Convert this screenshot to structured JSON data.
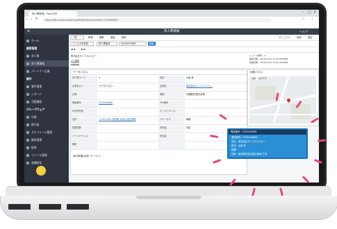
{
  "browser": {
    "tab_title": "求人票詳細 - PastCRM",
    "url": "https://file.cloud.example.jp/MMJ/fs/dir/entry/fkey/r=SU/0006SP"
  },
  "app": {
    "title": "求人票情報",
    "header_right": "ヘルプ"
  },
  "toolbar": {
    "back": "一覧",
    "new": "新規",
    "edit": "編集",
    "copy": "複製",
    "delete": "削除",
    "manual": "マニュアル",
    "print": "印刷",
    "settings": "設定"
  },
  "search": {
    "filter": "フィルタ未選択",
    "field": "求人票番号",
    "value": "000SKG5688",
    "button": "検索"
  },
  "record": {
    "company_label": "株式会社サンプルエスピー",
    "name": "山田",
    "meta1": "レコード番号：4",
    "meta2": "更新日時：2019/11/07 11:36 OPSMPB",
    "meta3": "登録日時：2019/11/07 11:04 OPSMPB"
  },
  "sidebar": {
    "items": [
      {
        "label": "ホーム",
        "header": false
      },
      {
        "label": "顧客管理",
        "header": true
      },
      {
        "label": "求人票",
        "header": false
      },
      {
        "label": "求人票情報",
        "header": false,
        "active": true
      },
      {
        "label": "パートナー企業",
        "header": false
      },
      {
        "label": "案件",
        "header": true
      },
      {
        "label": "案件管理",
        "header": false
      },
      {
        "label": "レポート",
        "header": false
      },
      {
        "label": "活動履歴",
        "header": false
      },
      {
        "label": "グループウェア",
        "header": true
      },
      {
        "label": "日報",
        "header": false
      },
      {
        "label": "掲示板",
        "header": false
      },
      {
        "label": "スケジュール管理",
        "header": false
      },
      {
        "label": "勤怠管理",
        "header": false
      },
      {
        "label": "経費",
        "header": false
      },
      {
        "label": "ファイル管理",
        "header": false
      },
      {
        "label": "各種設定",
        "header": false
      }
    ]
  },
  "panel": {
    "title": "データパネル",
    "fields": [
      {
        "label": "求人票コード",
        "value": "4",
        "label2": "担当",
        "value2": "山田 恵"
      },
      {
        "label": "企業名カナ",
        "value": "ヤマダエスピー",
        "label2": "企業名",
        "value2": "株式会社サンプルエスピー"
      },
      {
        "label": "企業",
        "value": "",
        "label2": "業種",
        "value2": "代理販売/取次店等"
      },
      {
        "label": "電話番号",
        "value": "0333445688",
        "label2": "FAX番号",
        "value2": ""
      },
      {
        "label": "本社所在地",
        "value": "",
        "label2": "ホームアドレス",
        "value2": ""
      },
      {
        "label": "住所",
        "value": "〒150-0022 東京都 渋谷区 恵比寿南",
        "label2": "ステータス",
        "value2": "稼働"
      },
      {
        "label": "従業員数",
        "value": "",
        "label2": "資本金",
        "value2": "未定"
      },
      {
        "label": "メールアドレス",
        "value": "",
        "label2": "担当者",
        "value2": ""
      },
      {
        "label": "備考",
        "value": "",
        "label2": "",
        "value2": ""
      }
    ],
    "footer_label": "添付書類(名刺 サーマン)"
  },
  "map": {
    "title": "地図パネル",
    "tab1": "地図",
    "tab2": "航空写真"
  },
  "popup": {
    "header": "電話番号：0333445688",
    "lines": [
      "電話番号：0333445688",
      "会社：株式会社サンプルエスピー",
      "担当：山田 恵",
      "部署：",
      "住所：東京都渋谷区恵比寿南1丁目"
    ]
  }
}
